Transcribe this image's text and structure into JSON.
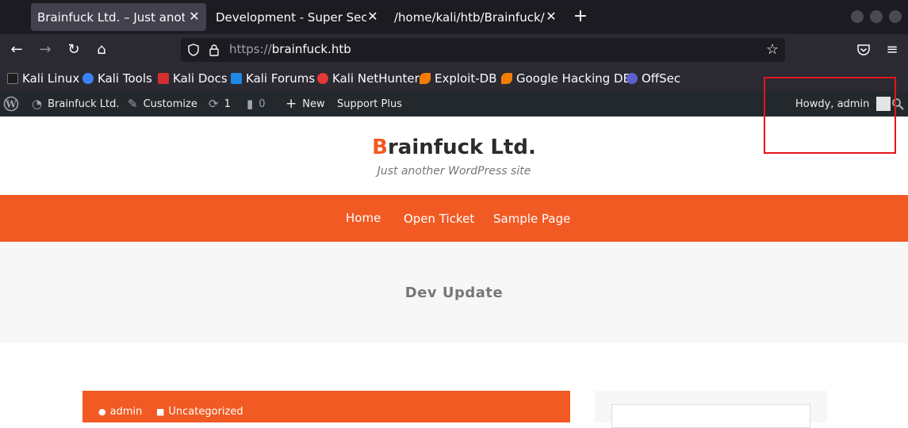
{
  "browser": {
    "tabs": [
      {
        "title": "Brainfuck Ltd. – Just another W",
        "close": "✕"
      },
      {
        "title": "Development - Super Secret F",
        "close": "✕"
      },
      {
        "title": "/home/kali/htb/Brainfuck/log",
        "close": "✕"
      }
    ],
    "new_tab": "+",
    "url_scheme": "https://",
    "url_host": "brainfuck.htb",
    "nav_icons": {
      "back": "←",
      "forward": "→",
      "reload": "↻",
      "home": "⌂",
      "star": "☆",
      "menu": "≡"
    }
  },
  "bookmarks": [
    {
      "label": "Kali Linux",
      "color": "#1d1d1d"
    },
    {
      "label": "Kali Tools",
      "color": "#3b82f6"
    },
    {
      "label": "Kali Docs",
      "color": "#d32f2f"
    },
    {
      "label": "Kali Forums",
      "color": "#1e88e5"
    },
    {
      "label": "Kali NetHunter",
      "color": "#e53935"
    },
    {
      "label": "Exploit-DB",
      "color": "#f57c00"
    },
    {
      "label": "Google Hacking DB",
      "color": "#f57c00"
    },
    {
      "label": "OffSec",
      "color": "#5e60ce"
    }
  ],
  "adminbar": {
    "site": "Brainfuck Ltd.",
    "customize": "Customize",
    "updates_count": "1",
    "comments_count": "0",
    "new": "New",
    "support": "Support Plus",
    "howdy": "Howdy, admin"
  },
  "site": {
    "title_first": "B",
    "title_rest": "rainfuck Ltd.",
    "tagline": "Just another WordPress site",
    "menu": [
      "Home",
      "Open Ticket",
      "Sample Page"
    ],
    "page_title": "Dev Update",
    "post_author": "admin",
    "post_category": "Uncategorized"
  },
  "colors": {
    "accent": "#f15a23",
    "annotation": "#e5141b"
  }
}
